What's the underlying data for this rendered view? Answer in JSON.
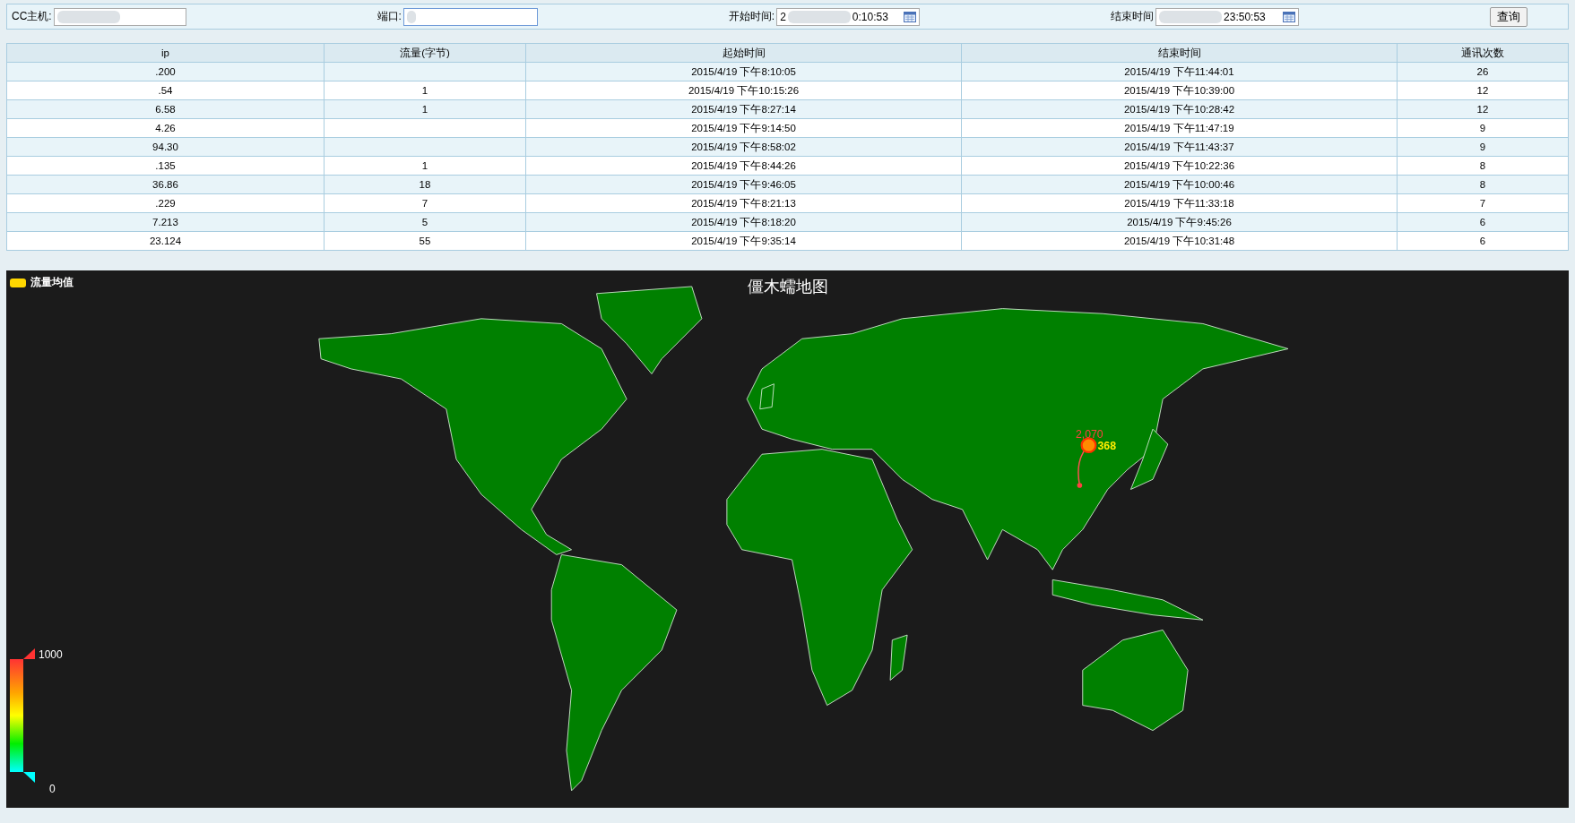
{
  "toolbar": {
    "host": {
      "label": "CC主机:"
    },
    "port": {
      "label": "端口:"
    },
    "start": {
      "label": "开始时间:",
      "value_parts": [
        "2",
        "0:10:53"
      ]
    },
    "end": {
      "label": "结束时间",
      "value": "23:50:53"
    },
    "query_button": "查询"
  },
  "table": {
    "columns": [
      "ip",
      "流量(字节)",
      "起始时间",
      "结束时间",
      "通讯次数"
    ],
    "rows": [
      {
        "ip": ".200",
        "start": "2015/4/19 下午8:10:05",
        "end": "2015/4/19 下午11:44:01",
        "count": "26"
      },
      {
        "ip": ".54",
        "traffic": "1",
        "start": "2015/4/19 下午10:15:26",
        "end": "2015/4/19 下午10:39:00",
        "count": "12"
      },
      {
        "ip": "6.58",
        "traffic": "1",
        "start": "2015/4/19 下午8:27:14",
        "end": "2015/4/19 下午10:28:42",
        "count": "12"
      },
      {
        "ip": "4.26",
        "start": "2015/4/19 下午9:14:50",
        "end": "2015/4/19 下午11:47:19",
        "count": "9"
      },
      {
        "ip": "94.30",
        "start": "2015/4/19 下午8:58:02",
        "end": "2015/4/19 下午11:43:37",
        "count": "9"
      },
      {
        "ip": ".135",
        "traffic": "1",
        "start": "2015/4/19 下午8:44:26",
        "end": "2015/4/19 下午10:22:36",
        "count": "8"
      },
      {
        "ip": "36.86",
        "traffic": "18",
        "start": "2015/4/19 下午9:46:05",
        "end": "2015/4/19 下午10:00:46",
        "count": "8"
      },
      {
        "ip": ".229",
        "traffic": "7",
        "start": "2015/4/19 下午8:21:13",
        "end": "2015/4/19 下午11:33:18",
        "count": "7"
      },
      {
        "ip": "7.213",
        "traffic": "5",
        "start": "2015/4/19 下午8:18:20",
        "end": "2015/4/19 下午9:45:26",
        "count": "6"
      },
      {
        "ip": "23.124",
        "traffic": "55",
        "start": "2015/4/19 下午9:35:14",
        "end": "2015/4/19 下午10:31:48",
        "count": "6"
      }
    ]
  },
  "map": {
    "title": "僵木蠕地图",
    "legend": {
      "label": "流量均值",
      "color": "#ffd700"
    },
    "scale": {
      "max": "1000",
      "min": "0"
    },
    "marker": {
      "source_label": "2,070",
      "target_label": "368"
    }
  }
}
